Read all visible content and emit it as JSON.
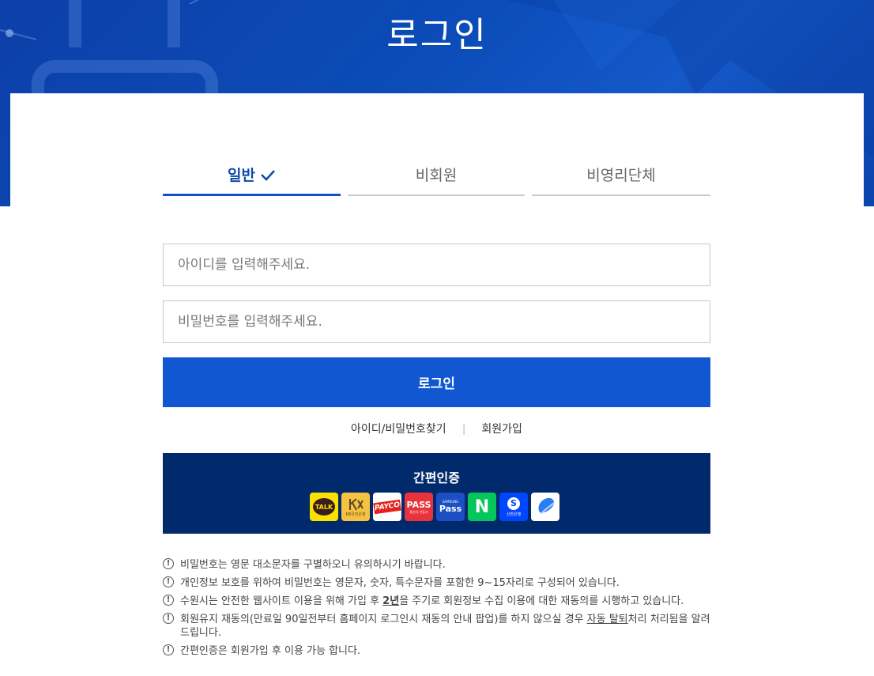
{
  "page": {
    "title": "로그인"
  },
  "tabs": [
    {
      "label": "일반",
      "active": true
    },
    {
      "label": "비회원",
      "active": false
    },
    {
      "label": "비영리단체",
      "active": false
    }
  ],
  "form": {
    "id_placeholder": "아이디를 입력해주세요.",
    "pw_placeholder": "비밀번호를 입력해주세요.",
    "login_label": "로그인"
  },
  "links": {
    "find": "아이디/비밀번호찾기",
    "signup": "회원가입"
  },
  "easy_auth": {
    "title": "간편인증",
    "providers": [
      {
        "name": "kakao-talk",
        "label": "TALK",
        "bg": "#fae100"
      },
      {
        "name": "kb-bank",
        "label": "KB국민은행",
        "bg": "#f5c242"
      },
      {
        "name": "payco",
        "label": "PAYCO",
        "bg": "#ffffff"
      },
      {
        "name": "pass",
        "label": "PASS",
        "sublabel": "통신사 인증서",
        "bg": "#e8323c"
      },
      {
        "name": "samsung-pass",
        "label": "Pass",
        "sublabel": "SAMSUNG",
        "bg": "#1d4fc4"
      },
      {
        "name": "naver",
        "label": "N",
        "bg": "#03c75a"
      },
      {
        "name": "shinhan",
        "label": "S",
        "sublabel": "신한은행",
        "bg": "#0046ff"
      },
      {
        "name": "toss",
        "label": "",
        "bg": "#ffffff"
      }
    ]
  },
  "notices": [
    "비밀번호는 영문 대소문자를 구별하오니 유의하시기 바랍니다.",
    "개인정보 보호를 위하여 비밀번호는 영문자, 숫자, 특수문자를 포함한 9~15자리로 구성되어 있습니다.",
    {
      "before": "수원시는 안전한 웹사이트 이용을 위해 가입 후 ",
      "emph": "2년",
      "after": "을 주기로 회원정보 수집 이용에 대한 재동의를 시행하고 있습니다."
    },
    {
      "before": "회원유지 재동의(만료일 90일전부터 홈페이지 로그인시 재동의 안내 팝업)를 하지 않으실 경우 ",
      "emph": "자동 탈퇴",
      "after": "처리 처리됨을 알려드립니다."
    },
    "간편인증은 회원가입 후 이용 가능 합니다."
  ]
}
